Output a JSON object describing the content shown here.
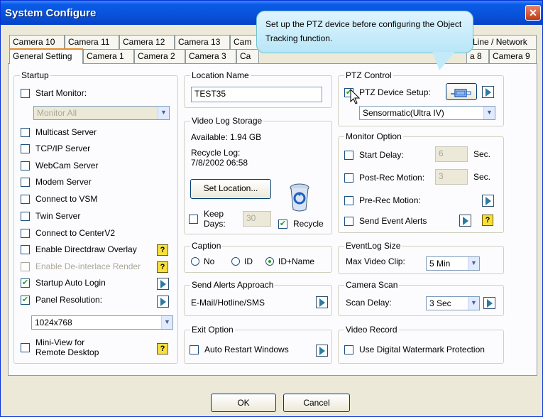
{
  "window": {
    "title": "System Configure",
    "close": "✕"
  },
  "tabs": {
    "row1": [
      "Camera 10",
      "Camera 11",
      "Camera 12",
      "Camera 13",
      "Cam",
      "Line / Network"
    ],
    "row2": [
      "General Setting",
      "Camera 1",
      "Camera 2",
      "Camera 3",
      "Ca",
      "a 8",
      "Camera 9"
    ]
  },
  "callout": {
    "text": "Set up the PTZ device before configuring the Object Tracking function."
  },
  "startup": {
    "title": "Startup",
    "start_monitor": "Start Monitor:",
    "monitor_select": "Monitor All",
    "items": [
      "Multicast Server",
      "TCP/IP Server",
      "WebCam Server",
      "Modem Server",
      "Connect to VSM",
      "Twin Server",
      "Connect to CenterV2"
    ],
    "directdraw": "Enable Directdraw Overlay",
    "deinterlace": "Enable De-interlace Render",
    "auto_login": "Startup Auto Login",
    "panel_res": "Panel Resolution:",
    "resolution": "1024x768",
    "mini_view_1": "Mini-View for",
    "mini_view_2": "Remote Desktop",
    "help": "?"
  },
  "location": {
    "title": "Location Name",
    "value": "TEST35"
  },
  "storage": {
    "title": "Video Log Storage",
    "available": "Available: 1.94 GB",
    "recycle_log_1": "Recycle Log:",
    "recycle_log_2": "7/8/2002 06:58",
    "set_location": "Set Location...",
    "keep_1": "Keep",
    "keep_2": "Days:",
    "keep_value": "30",
    "recycle": "Recycle"
  },
  "caption": {
    "title": "Caption",
    "options": [
      "No",
      "ID",
      "ID+Name"
    ]
  },
  "alerts": {
    "title": "Send Alerts Approach",
    "text": "E-Mail/Hotline/SMS"
  },
  "exit": {
    "title": "Exit Option",
    "auto_restart": "Auto Restart Windows"
  },
  "ptz": {
    "title": "PTZ Control",
    "setup": "PTZ Device Setup:",
    "device": "Sensormatic(Ultra IV)"
  },
  "monitor": {
    "title": "Monitor Option",
    "start_delay": "Start Delay:",
    "start_delay_value": "6",
    "post_rec": "Post-Rec Motion:",
    "post_rec_value": "3",
    "sec": "Sec.",
    "pre_rec": "Pre-Rec Motion:",
    "event_alerts": "Send Event Alerts",
    "help": "?"
  },
  "eventlog": {
    "title": "EventLog Size",
    "label": "Max Video Clip:",
    "value": "5 Min"
  },
  "scan": {
    "title": "Camera Scan",
    "label": "Scan Delay:",
    "value": "3 Sec"
  },
  "video_record": {
    "title": "Video Record",
    "watermark": "Use Digital Watermark Protection"
  },
  "buttons": {
    "ok": "OK",
    "cancel": "Cancel"
  }
}
